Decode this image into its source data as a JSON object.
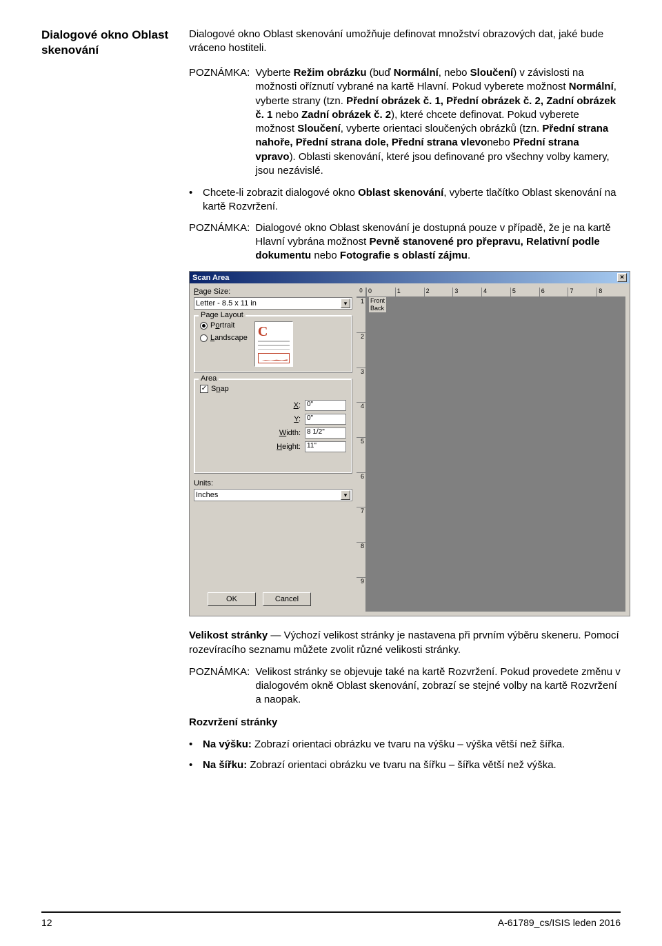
{
  "side_heading": "Dialogové okno Oblast skenování",
  "intro": "Dialogové okno Oblast skenování umožňuje definovat množství obrazových dat, jaké bude vráceno hostiteli.",
  "note1_label": "POZNÁMKA:",
  "note1_body_html": "Vyberte <b>Režim obrázku</b> (buď <b>Normální</b>, nebo <b>Sloučení</b>) v závislosti na možnosti oříznutí vybrané na kartě Hlavní. Pokud vyberete možnost <b>Normální</b>, vyberte strany (tzn. <b>Přední obrázek č. 1, Přední obrázek č. 2, Zadní obrázek č. 1</b> nebo <b>Zadní obrázek č. 2</b>), které chcete definovat. Pokud vyberete možnost <b>Sloučení</b>, vyberte orientaci sloučených obrázků (tzn. <b>Přední strana nahoře, Přední strana dole, Přední strana vlevo</b>nebo <b>Přední strana vpravo</b>). Oblasti skenování, které jsou definované pro všechny volby kamery, jsou nezávislé.",
  "bullet1_html": "Chcete-li zobrazit dialogové okno <b>Oblast skenování</b>, vyberte tlačítko Oblast skenování na kartě Rozvržení.",
  "note2_label": "POZNÁMKA:",
  "note2_body_html": "Dialogové okno Oblast skenování je dostupná pouze v případě, že je na kartě Hlavní vybrána možnost <b>Pevně stanovené pro přepravu, Relativní podle dokumentu</b> nebo <b>Fotografie s oblastí zájmu</b>.",
  "dialog": {
    "title": "Scan Area",
    "page_size_label": "Page Size:",
    "page_size_value": "Letter - 8.5 x 11 in",
    "page_layout_label": "Page Layout",
    "portrait": "Portrait",
    "landscape": "Landscape",
    "area_label": "Area",
    "snap": "Snap",
    "x_label": "X:",
    "x_value": "0\"",
    "y_label": "Y:",
    "y_value": "0\"",
    "width_label": "Width:",
    "width_value": "8 1/2\"",
    "height_label": "Height:",
    "height_value": "11\"",
    "units_label": "Units:",
    "units_value": "Inches",
    "ok": "OK",
    "cancel": "Cancel",
    "ruler_zero": "0",
    "ticks_h": [
      "1",
      "2",
      "3",
      "4",
      "5",
      "6",
      "7",
      "8"
    ],
    "ticks_v": [
      "1",
      "2",
      "3",
      "4",
      "5",
      "6",
      "7",
      "8",
      "9"
    ],
    "front": "Front",
    "back": "Back"
  },
  "para_size_html": "<b>Velikost stránky</b> — Výchozí velikost stránky je nastavena při prvním výběru skeneru. Pomocí rozevíracího seznamu můžete zvolit různé velikosti stránky.",
  "note3_label": "POZNÁMKA:",
  "note3_body": "Velikost stránky se objevuje také na kartě Rozvržení. Pokud provedete změnu v dialogovém okně Oblast skenování, zobrazí se stejné volby na kartě Rozvržení a naopak.",
  "layout_heading": "Rozvržení stránky",
  "bullet2_html": "<b>Na výšku:</b> Zobrazí orientaci obrázku ve tvaru na výšku – výška větší než šířka.",
  "bullet3_html": "<b>Na šířku:</b> Zobrazí orientaci obrázku ve tvaru na šířku – šířka větší než výška.",
  "footer_left": "12",
  "footer_right": "A-61789_cs/ISIS leden 2016"
}
